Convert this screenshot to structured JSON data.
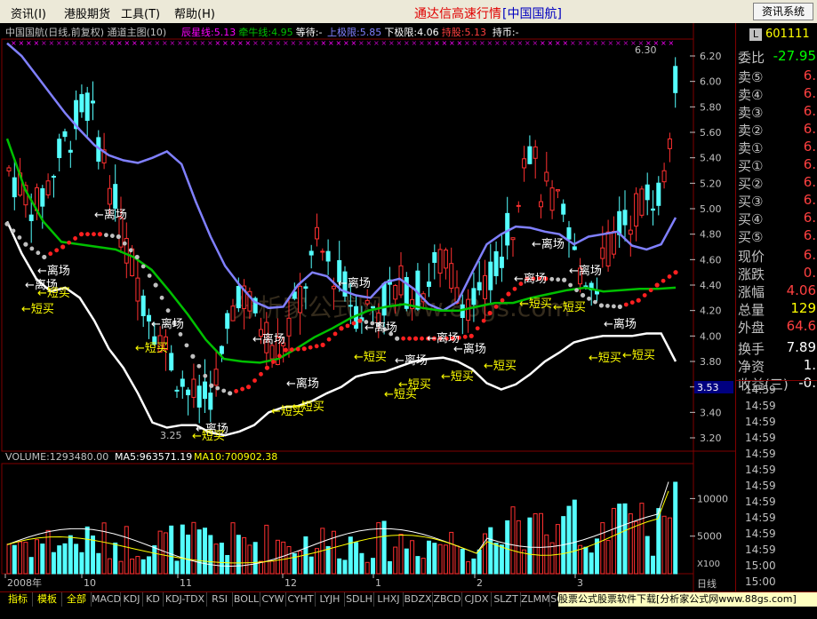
{
  "menu": {
    "items": [
      "资讯(I)",
      "港股期货",
      "工具(T)",
      "帮助(H)"
    ],
    "title": "通达信高速行情",
    "title_stock": "[中国国航]",
    "right_button": "资讯系统"
  },
  "main_panel": {
    "header_title": "中国国航(日线,前复权) 通道主图(10)",
    "indicators": [
      {
        "label": "辰星线:5.13",
        "color": "#ff00ff"
      },
      {
        "label": "牵牛线:4.95",
        "color": "#00c000"
      },
      {
        "label": "等待:-",
        "color": "#ffffff"
      },
      {
        "label": "上极限:5.85",
        "color": "#8080ff"
      },
      {
        "label": "下极限:4.06",
        "color": "#ffffff"
      },
      {
        "label": "持股:5.13",
        "color": "#ff4040"
      },
      {
        "label": "持币:-",
        "color": "#ffffff"
      }
    ],
    "price_ticks": [
      "6.20",
      "6.00",
      "5.80",
      "5.60",
      "5.40",
      "5.20",
      "5.00",
      "4.80",
      "4.60",
      "4.40",
      "4.20",
      "4.00",
      "3.80",
      "3.60",
      "3.40",
      "3.20"
    ],
    "current_price_tag": "3.53",
    "high_label": "6.30",
    "low_label": "3.25",
    "watermark": "分析家公式网www.88gs.com"
  },
  "volume_panel": {
    "header": "VOLUME:1293480.00",
    "ma5": "MA5:963571.19",
    "ma10": "MA10:700902.38",
    "vol_ticks": [
      "10000",
      "5000"
    ],
    "multiplier": "X100"
  },
  "x_axis": {
    "labels": [
      "2008年",
      "10",
      "11",
      "12",
      "1",
      "2",
      "3"
    ],
    "right_label": "日线"
  },
  "side_panel": {
    "code": "601111",
    "code_badge": "L",
    "rows": [
      {
        "label": "委比",
        "value": "-27.95",
        "color": "#00ff00"
      },
      {
        "label": "卖⑤",
        "value": "6.",
        "color": "#ff4040"
      },
      {
        "label": "卖④",
        "value": "6.",
        "color": "#ff4040"
      },
      {
        "label": "卖③",
        "value": "6.",
        "color": "#ff4040"
      },
      {
        "label": "卖②",
        "value": "6.",
        "color": "#ff4040"
      },
      {
        "label": "卖①",
        "value": "6.",
        "color": "#ff4040"
      },
      {
        "label": "买①",
        "value": "6.",
        "color": "#ff4040"
      },
      {
        "label": "买②",
        "value": "6.",
        "color": "#ff4040"
      },
      {
        "label": "买③",
        "value": "6.",
        "color": "#ff4040"
      },
      {
        "label": "买④",
        "value": "6.",
        "color": "#ff4040"
      },
      {
        "label": "买⑤",
        "value": "6.",
        "color": "#ff4040"
      },
      {
        "label": "现价",
        "value": "6.",
        "color": "#ff4040"
      },
      {
        "label": "涨跌",
        "value": "0.",
        "color": "#ff4040"
      },
      {
        "label": "涨幅",
        "value": "4.06",
        "color": "#ff4040"
      },
      {
        "label": "总量",
        "value": "129",
        "color": "#ffff00"
      },
      {
        "label": "外盘",
        "value": "64.6",
        "color": "#ff4040"
      },
      {
        "label": "换手",
        "value": "7.89",
        "color": "#ffffff"
      },
      {
        "label": "净资",
        "value": "1.",
        "color": "#ffffff"
      },
      {
        "label": "收益(三)",
        "value": "-0.",
        "color": "#ffffff"
      }
    ],
    "times": [
      "14:59",
      "14:59",
      "14:59",
      "14:59",
      "14:59",
      "14:59",
      "14:59",
      "14:59",
      "14:59",
      "14:59",
      "14:59",
      "15:00",
      "15:00",
      "15:00"
    ]
  },
  "tabs": [
    "指标",
    "模板",
    "全部",
    "MACD",
    "KDJ",
    "KD",
    "KDJ-TDX",
    "RSI",
    "BOLL",
    "CYW",
    "CYHT",
    "LYJH",
    "SDLH",
    "LHXJ",
    "BDZX",
    "ZBCD",
    "CJDX",
    "SLZT",
    "ZLMM",
    "SG-L"
  ],
  "ad_text": "股票公式股票软件下载[分析家公式网www.88gs.com]",
  "signals": {
    "li_chang": "离场",
    "duan_mai": "短买"
  },
  "chart_data": {
    "type": "candlestick",
    "title": "中国国航(日线,前复权)",
    "ylim": [
      3.2,
      6.3
    ],
    "volume_ylim": [
      0,
      13000
    ],
    "volume_unit": "X100",
    "x_axis_labels": [
      "2008年",
      "10",
      "11",
      "12",
      "1",
      "2",
      "3"
    ],
    "series": [
      {
        "name": "上极限",
        "color": "#8080ff",
        "values": [
          6.3,
          6.2,
          6.05,
          5.9,
          5.75,
          5.62,
          5.5,
          5.42,
          5.38,
          5.36,
          5.4,
          5.45,
          5.35,
          5.05,
          4.78,
          4.55,
          4.4,
          4.27,
          4.22,
          4.23,
          4.4,
          4.5,
          4.47,
          4.36,
          4.32,
          4.3,
          4.42,
          4.45,
          4.37,
          4.25,
          4.2,
          4.27,
          4.5,
          4.72,
          4.8,
          4.86,
          4.85,
          4.82,
          4.8,
          4.72,
          4.78,
          4.8,
          4.82,
          4.71,
          4.68,
          4.72,
          4.93
        ]
      },
      {
        "name": "下极限",
        "color": "#ffffff",
        "values": [
          4.9,
          4.65,
          4.45,
          4.35,
          4.38,
          4.3,
          4.12,
          3.9,
          3.75,
          3.55,
          3.32,
          3.28,
          3.3,
          3.3,
          3.24,
          3.22,
          3.25,
          3.3,
          3.4,
          3.44,
          3.45,
          3.49,
          3.55,
          3.6,
          3.68,
          3.71,
          3.72,
          3.76,
          3.8,
          3.82,
          3.83,
          3.8,
          3.74,
          3.63,
          3.58,
          3.62,
          3.7,
          3.8,
          3.87,
          3.95,
          3.98,
          4.0,
          4.0,
          4.0,
          4.02,
          4.02,
          3.8
        ]
      },
      {
        "name": "牵牛线",
        "color": "#00c000",
        "values": [
          5.55,
          5.15,
          4.9,
          4.74,
          4.72,
          4.7,
          4.68,
          4.62,
          4.52,
          4.35,
          4.17,
          3.97,
          3.82,
          3.8,
          3.79,
          3.82,
          3.9,
          3.99,
          4.06,
          4.14,
          4.2,
          4.23,
          4.25,
          4.22,
          4.2,
          4.2,
          4.23,
          4.26,
          4.26,
          4.3,
          4.33,
          4.36,
          4.38,
          4.35,
          4.36,
          4.37,
          4.37,
          4.38
        ]
      },
      {
        "name": "辰星线",
        "color": "#ff00ff",
        "values": [
          4.88,
          4.72,
          4.62,
          4.7,
          4.8,
          4.8,
          4.78,
          4.62,
          4.4,
          4.1,
          3.84,
          3.61,
          3.55,
          3.6,
          3.75,
          3.89,
          3.9,
          3.93,
          4.06,
          4.12,
          4.09,
          3.98,
          3.98,
          3.98,
          3.98,
          4.0,
          4.18,
          4.33,
          4.45,
          4.45,
          4.44,
          4.32,
          4.24,
          4.23,
          4.28,
          4.4,
          4.5
        ]
      },
      {
        "name": "MA5",
        "color": "#ffffff"
      },
      {
        "name": "MA10",
        "color": "#ffff00"
      }
    ]
  }
}
